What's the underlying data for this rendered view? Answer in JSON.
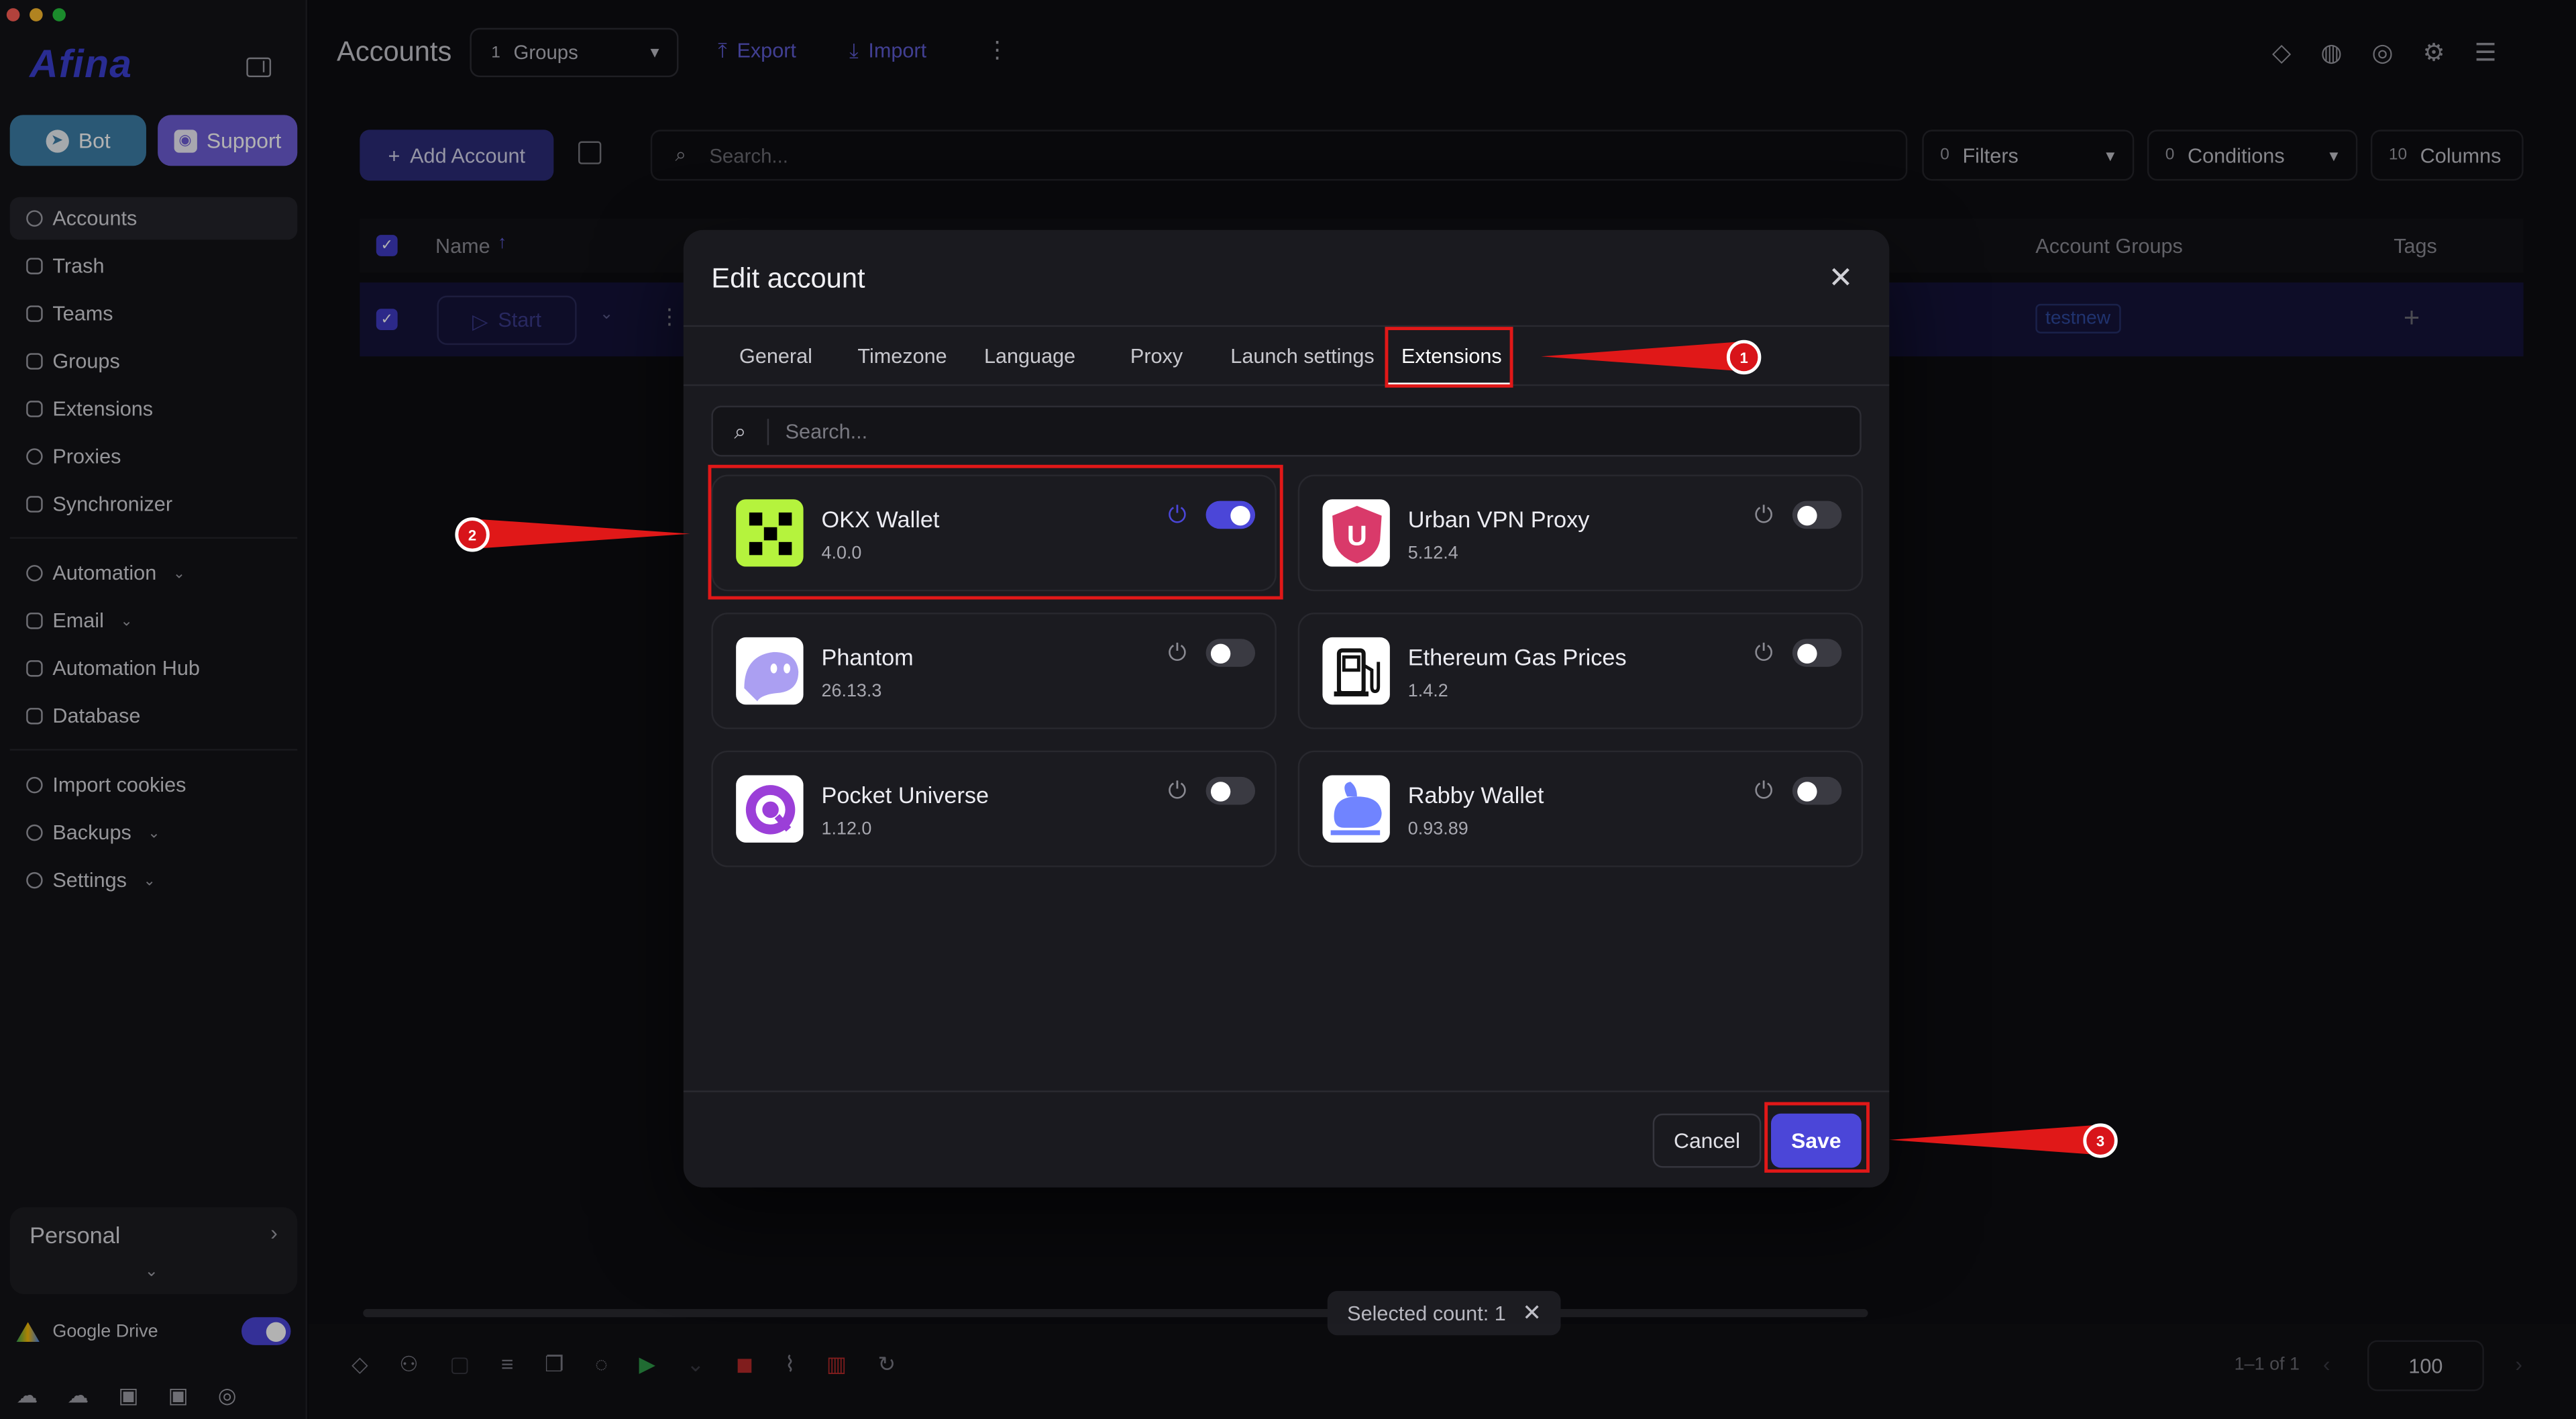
{
  "app": {
    "logo_text": "Afina",
    "page_title": "Accounts"
  },
  "sidebar": {
    "bot_label": "Bot",
    "support_label": "Support",
    "nav_group1": [
      "Accounts",
      "Trash",
      "Teams",
      "Groups",
      "Extensions",
      "Proxies",
      "Synchronizer"
    ],
    "nav_group2": [
      "Automation",
      "Email",
      "Automation Hub",
      "Database"
    ],
    "nav_group3": [
      "Import cookies",
      "Backups",
      "Settings"
    ],
    "items": {
      "accounts": "Accounts",
      "trash": "Trash",
      "teams": "Teams",
      "groups": "Groups",
      "extensions": "Extensions",
      "proxies": "Proxies",
      "synchronizer": "Synchronizer",
      "automation": "Automation",
      "email": "Email",
      "automation_hub": "Automation Hub",
      "database": "Database",
      "import_cookies": "Import cookies",
      "backups": "Backups",
      "settings": "Settings"
    },
    "workspace": "Personal",
    "google_drive": "Google Drive"
  },
  "toolbar": {
    "groups_count": "1",
    "groups_label": "Groups",
    "export_label": "Export",
    "import_label": "Import",
    "add_account_label": "Add Account",
    "search_placeholder": "Search...",
    "filters_count": "0",
    "filters_label": "Filters",
    "conditions_count": "0",
    "conditions_label": "Conditions",
    "columns_count": "10",
    "columns_label": "Columns"
  },
  "table": {
    "headers": {
      "name": "Name",
      "account_groups": "Account Groups",
      "tags": "Tags"
    },
    "row": {
      "start_label": "Start",
      "group_tag": "testnew"
    }
  },
  "footer": {
    "selected_count": "Selected count: 1",
    "pagination": "1–1 of 1",
    "page_size": "100"
  },
  "modal": {
    "title": "Edit account",
    "tabs": [
      "General",
      "Timezone",
      "Language",
      "Proxy",
      "Launch settings",
      "Extensions"
    ],
    "tab_labels": {
      "general": "General",
      "timezone": "Timezone",
      "language": "Language",
      "proxy": "Proxy",
      "launch": "Launch settings",
      "extensions": "Extensions"
    },
    "active_tab": "Extensions",
    "search_placeholder": "Search...",
    "extensions": [
      {
        "name": "OKX Wallet",
        "version": "4.0.0",
        "enabled": true
      },
      {
        "name": "Urban VPN Proxy",
        "version": "5.12.4",
        "enabled": false
      },
      {
        "name": "Phantom",
        "version": "26.13.3",
        "enabled": false
      },
      {
        "name": "Ethereum Gas Prices",
        "version": "1.4.2",
        "enabled": false
      },
      {
        "name": "Pocket Universe",
        "version": "1.12.0",
        "enabled": false
      },
      {
        "name": "Rabby Wallet",
        "version": "0.93.89",
        "enabled": false
      }
    ],
    "cancel_label": "Cancel",
    "save_label": "Save"
  },
  "annotations": {
    "step1": "1",
    "step2": "2",
    "step3": "3"
  },
  "colors": {
    "accent": "#4b46d8",
    "highlight": "#e01818",
    "background": "#0c0c10"
  }
}
